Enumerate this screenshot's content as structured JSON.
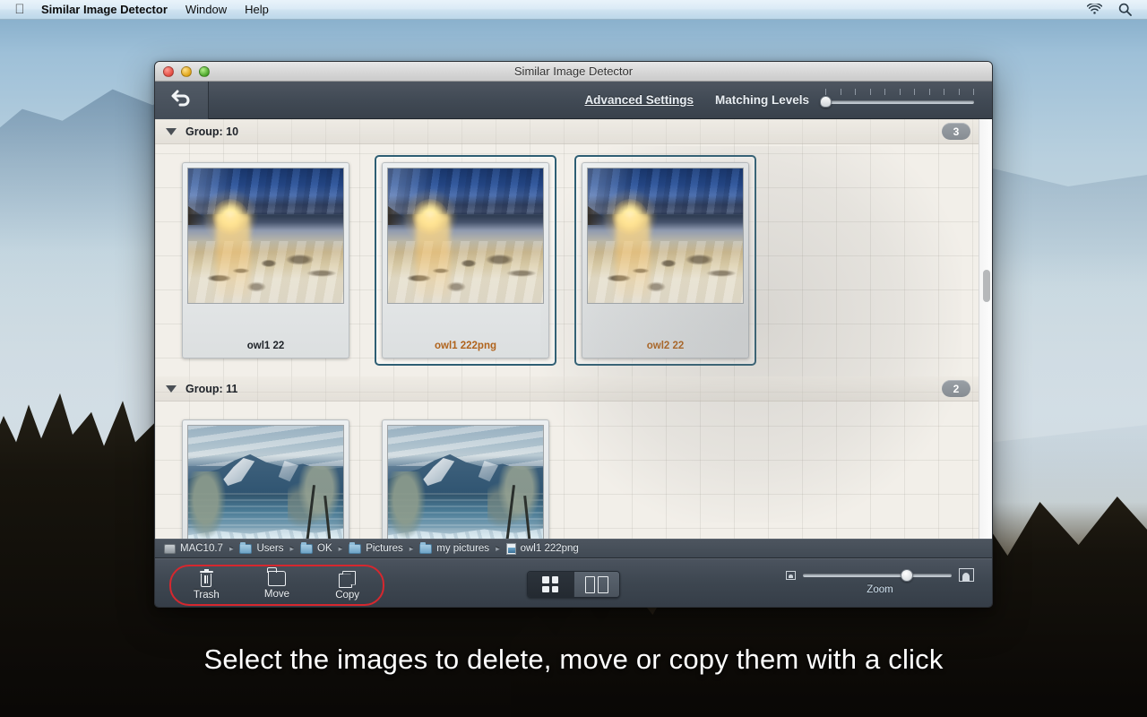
{
  "menubar": {
    "apple_icon": "apple-icon",
    "app_name": "Similar Image Detector",
    "items": [
      "Window",
      "Help"
    ],
    "status_icons": [
      "wifi-icon",
      "spotlight-search-icon"
    ]
  },
  "window": {
    "title": "Similar Image Detector",
    "traffic_lights": [
      "close",
      "minimize",
      "zoom"
    ]
  },
  "toolbar": {
    "back_icon": "back-arrow-icon",
    "advanced_settings": "Advanced Settings",
    "matching_levels_label": "Matching Levels",
    "matching_levels_value": 0,
    "matching_levels_ticks": 11
  },
  "groups": [
    {
      "disclosure": "triangle-down-icon",
      "title": "Group: 10",
      "count": "3",
      "items": [
        {
          "caption": "owl1 22",
          "selected": false,
          "art": "beach-sunset"
        },
        {
          "caption": "owl1 222png",
          "selected": true,
          "art": "beach-sunset"
        },
        {
          "caption": "owl2 22",
          "selected": true,
          "art": "beach-sunset"
        }
      ]
    },
    {
      "disclosure": "triangle-down-icon",
      "title": "Group: 11",
      "count": "2",
      "items": [
        {
          "caption": "",
          "selected": false,
          "art": "mountain-lake"
        },
        {
          "caption": "",
          "selected": false,
          "art": "mountain-lake"
        }
      ]
    }
  ],
  "pathbar": {
    "segments": [
      {
        "icon": "hard-disk-icon",
        "label": "MAC10.7"
      },
      {
        "icon": "folder-users-icon",
        "label": "Users"
      },
      {
        "icon": "folder-icon",
        "label": "OK"
      },
      {
        "icon": "folder-icon",
        "label": "Pictures"
      },
      {
        "icon": "folder-icon",
        "label": "my pictures"
      },
      {
        "icon": "image-document-icon",
        "label": "owl1 222png"
      }
    ],
    "separator": "▸"
  },
  "bottombar": {
    "actions": [
      {
        "icon": "trash-icon",
        "label": "Trash"
      },
      {
        "icon": "folder-move-icon",
        "label": "Move"
      },
      {
        "icon": "copy-icon",
        "label": "Copy"
      }
    ],
    "highlight_color": "#d6272e",
    "view_modes": [
      {
        "icon": "grid-view-icon",
        "selected": true
      },
      {
        "icon": "two-column-view-icon",
        "selected": false
      }
    ],
    "zoom_label": "Zoom",
    "zoom_value": 70,
    "zoom_min_icon": "small-image-icon",
    "zoom_max_icon": "large-image-icon"
  },
  "caption": "Select the images to delete, move or copy them with a click",
  "colors": {
    "selection_border": "#2e5e73",
    "selected_caption": "#b0631c",
    "normal_caption": "#20242a",
    "highlight_red": "#d6272e",
    "toolbar_dark": "#414a55"
  }
}
